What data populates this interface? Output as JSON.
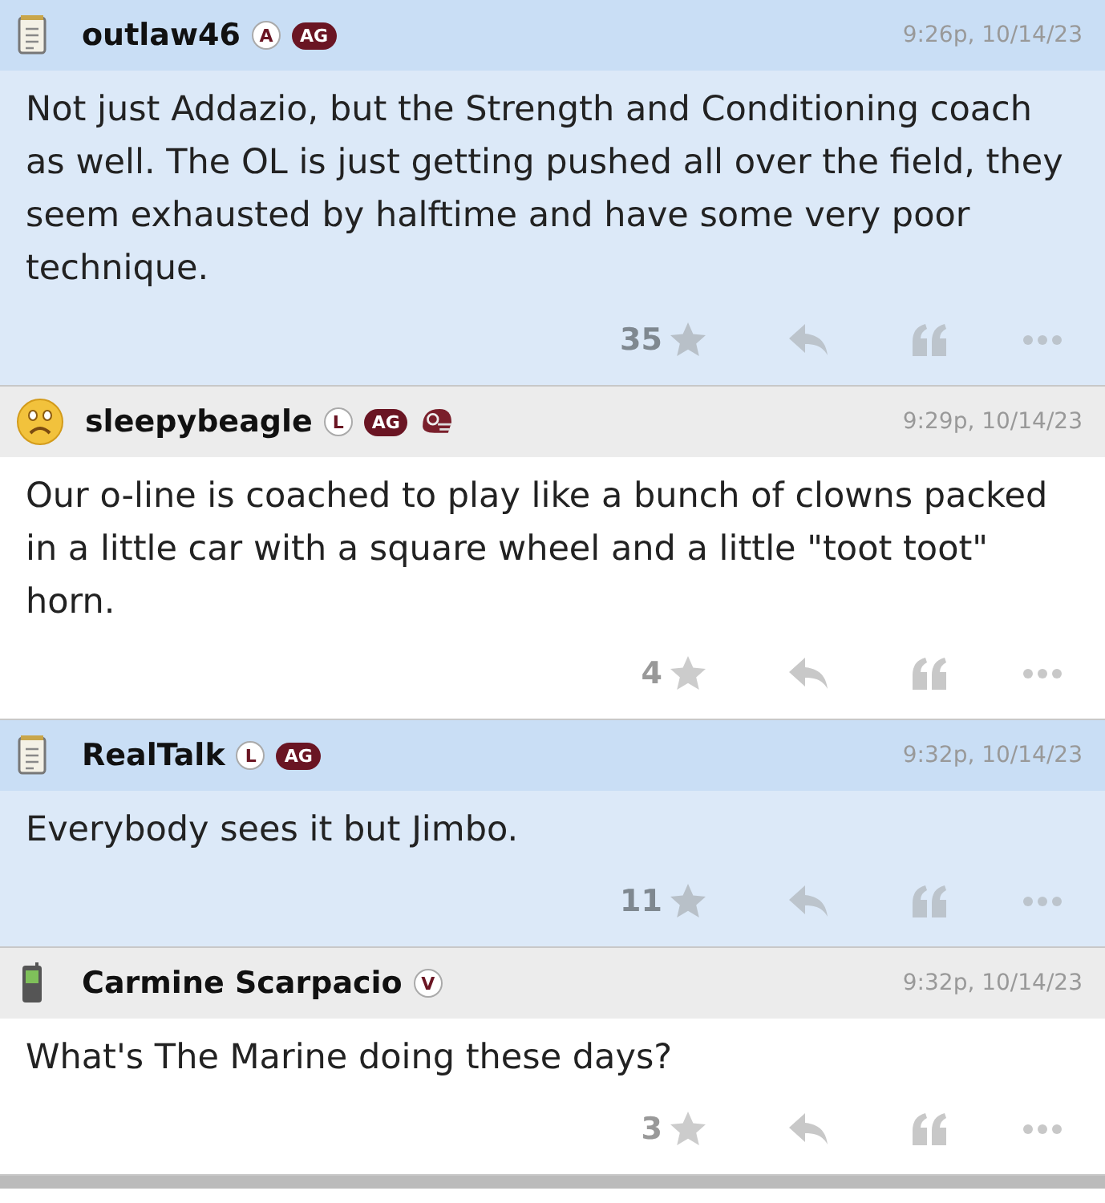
{
  "posts": [
    {
      "author": "outlaw46",
      "avatar": {
        "kind": "notepad"
      },
      "highlighted": true,
      "badges": [
        {
          "kind": "letter",
          "text": "A"
        },
        {
          "kind": "tag",
          "text": "AG"
        }
      ],
      "time": "9:26p, 10/14/23",
      "text": "Not just Addazio, but the Strength and Conditioning coach as well. The OL is just getting pushed all over the field, they seem exhausted by halftime and have some very poor technique.",
      "stars": "35"
    },
    {
      "author": "sleepybeagle",
      "avatar": {
        "kind": "frown"
      },
      "highlighted": false,
      "badges": [
        {
          "kind": "letter",
          "text": "L"
        },
        {
          "kind": "tag",
          "text": "AG"
        },
        {
          "kind": "helmet"
        }
      ],
      "time": "9:29p, 10/14/23",
      "text": "Our o-line is coached to play like a bunch of clowns packed in a little car with a square wheel and a little \"toot toot\" horn.",
      "stars": "4"
    },
    {
      "author": "RealTalk",
      "avatar": {
        "kind": "notepad"
      },
      "highlighted": true,
      "badges": [
        {
          "kind": "letter",
          "text": "L"
        },
        {
          "kind": "tag",
          "text": "AG"
        }
      ],
      "time": "9:32p, 10/14/23",
      "text": "Everybody sees it but Jimbo.",
      "stars": "11"
    },
    {
      "author": "Carmine Scarpacio",
      "avatar": {
        "kind": "phone"
      },
      "highlighted": false,
      "badges": [
        {
          "kind": "letter",
          "text": "V"
        }
      ],
      "time": "9:32p, 10/14/23",
      "text": "What's The Marine doing these days?",
      "stars": "3"
    }
  ]
}
